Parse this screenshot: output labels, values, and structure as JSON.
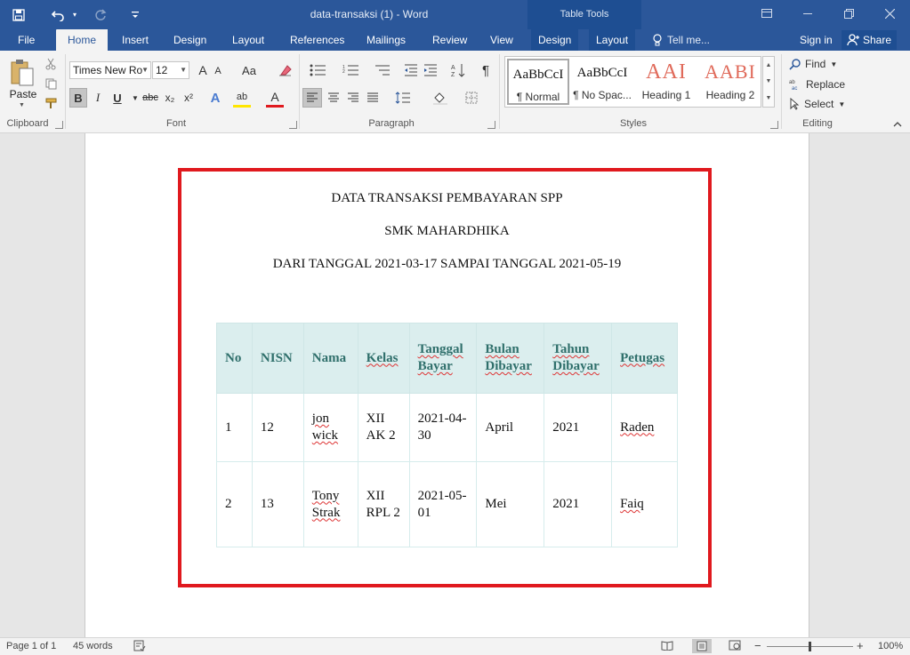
{
  "window": {
    "title": "data-transaksi (1) - Word",
    "context_tab_group": "Table Tools",
    "controls": {
      "restore_ribbon": "ribbon-display-icon",
      "minimize": "minimize-icon",
      "maximize": "maximize-icon",
      "close": "close-icon"
    }
  },
  "qat": {
    "save": "save-icon",
    "undo": "undo-icon",
    "redo": "redo-icon",
    "customize": "customize-qat-icon"
  },
  "tabs": {
    "file": "File",
    "home": "Home",
    "insert": "Insert",
    "design": "Design",
    "layout": "Layout",
    "references": "References",
    "mailings": "Mailings",
    "review": "Review",
    "view": "View",
    "tt_design": "Design",
    "tt_layout": "Layout",
    "tellme": "Tell me...",
    "signin": "Sign in",
    "share": "Share"
  },
  "ribbon": {
    "clipboard": {
      "label": "Clipboard",
      "paste": "Paste"
    },
    "font": {
      "label": "Font",
      "font_name": "Times New Ro",
      "font_size": "12",
      "buttons": {
        "bold": "B",
        "italic": "I",
        "underline": "U",
        "strike": "abc",
        "subscript": "x₂",
        "superscript": "x²",
        "grow": "A",
        "shrink": "A",
        "case": "Aa",
        "font_color": "A",
        "highlight": "ab"
      }
    },
    "paragraph": {
      "label": "Paragraph"
    },
    "styles": {
      "label": "Styles",
      "items": [
        {
          "sample": "AaBbCcI",
          "name": "¶ Normal"
        },
        {
          "sample": "AaBbCcI",
          "name": "¶ No Spac..."
        },
        {
          "sample": "AAI",
          "name": "Heading 1"
        },
        {
          "sample": "AABI",
          "name": "Heading 2"
        }
      ]
    },
    "editing": {
      "label": "Editing",
      "find": "Find",
      "replace": "Replace",
      "select": "Select"
    }
  },
  "document": {
    "line1": "DATA TRANSAKSI PEMBAYARAN SPP",
    "line2": "SMK MAHARDHIKA",
    "line3": "DARI TANGGAL 2021-03-17 SAMPAI TANGGAL 2021-05-19",
    "table": {
      "headers": [
        "No",
        "NISN",
        "Nama",
        "Kelas",
        "Tanggal Bayar",
        "Bulan Dibayar",
        "Tahun Dibayar",
        "Petugas"
      ],
      "rows": [
        {
          "no": "1",
          "nisn": "12",
          "nama": "jon wick",
          "kelas": "XII AK 2",
          "tanggal": "2021-04-30",
          "bulan": "April",
          "tahun": "2021",
          "petugas": "Raden"
        },
        {
          "no": "2",
          "nisn": "13",
          "nama": "Tony Strak",
          "kelas": "XII RPL 2",
          "tanggal": "2021-05-01",
          "bulan": "Mei",
          "tahun": "2021",
          "petugas": "Faiq"
        }
      ]
    }
  },
  "status": {
    "page": "Page 1 of 1",
    "words": "45 words",
    "zoom": "100%"
  },
  "colors": {
    "ribbon_blue": "#2b579a",
    "frame_red": "#e0191e",
    "header_fill": "#dbeeee",
    "header_text": "#2f6f6b"
  }
}
